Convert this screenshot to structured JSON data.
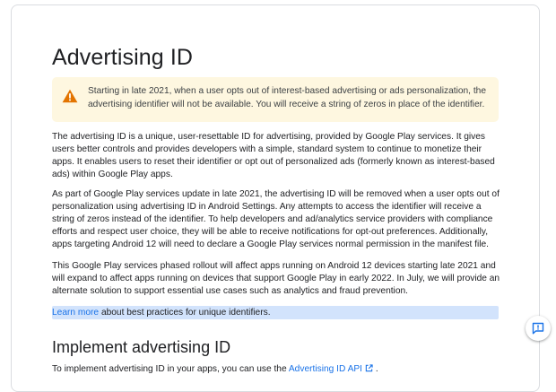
{
  "page": {
    "title": "Advertising ID",
    "warning": {
      "icon": "warning-icon",
      "text": "Starting in late 2021, when a user opts out of interest-based advertising or ads personalization, the advertising identifier will not be available. You will receive a string of zeros in place of the identifier."
    },
    "paragraphs": [
      "The advertising ID is a unique, user-resettable ID for advertising, provided by Google Play services. It gives users better controls and provides developers with a simple, standard system to continue to monetize their apps. It enables users to reset their identifier or opt out of personalized ads (formerly known as interest-based ads) within Google Play apps.",
      "As part of Google Play services update in late 2021, the advertising ID will be removed when a user opts out of personalization using advertising ID in Android Settings. Any attempts to access the identifier will receive a string of zeros instead of the identifier. To help developers and ad/analytics service providers with compliance efforts and respect user choice, they will be able to receive notifications for opt-out preferences. Additionally, apps targeting Android 12 will need to declare a Google Play services normal permission in the manifest file.",
      "This Google Play services phased rollout will affect apps running on Android 12 devices starting late 2021 and will expand to affect apps running on devices that support Google Play in early 2022. In July, we will provide an alternate solution to support essential use cases such as analytics and fraud prevention."
    ],
    "learn_more": {
      "link": "Learn more",
      "text": " about best practices for unique identifiers."
    },
    "section_title": "Implement advertising ID",
    "implement": {
      "prefix": "To implement advertising ID in your apps, you can use the ",
      "link": "Advertising ID API",
      "suffix": " ."
    },
    "colors": {
      "warning_bg": "#fef7e0",
      "warning_icon": "#e37400",
      "link": "#1a73e8",
      "highlight": "#d2e3fc"
    },
    "feedback_icon": "feedback-icon"
  }
}
